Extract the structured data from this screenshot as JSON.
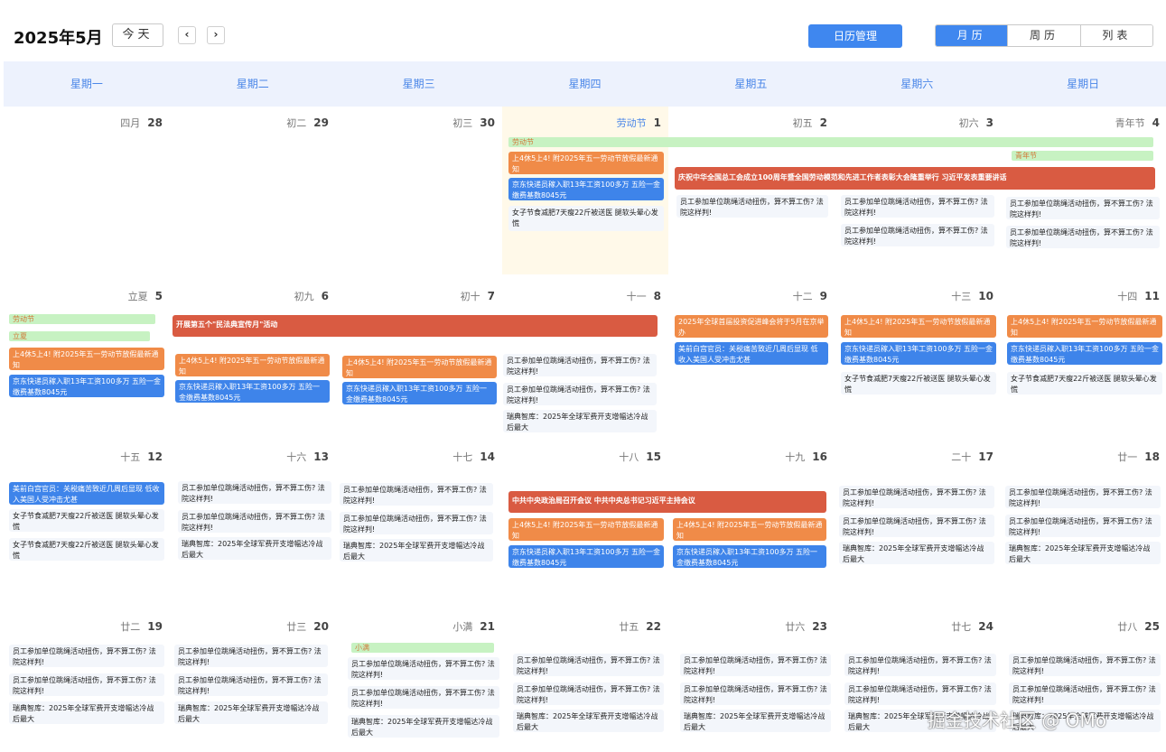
{
  "toolbar": {
    "month_title": "2025年5月",
    "today_label": "今天",
    "prev_icon": "‹",
    "next_icon": "›",
    "manage_label": "日历管理",
    "views": [
      "月历",
      "周历",
      "列表"
    ],
    "active_view": "月历"
  },
  "weekdays": [
    "星期一",
    "星期二",
    "星期三",
    "星期四",
    "星期五",
    "星期六",
    "星期日"
  ],
  "colors": {
    "accent": "#3f87ef",
    "orange": "#f08b48",
    "blue": "#3e84ea",
    "red": "#d95b42",
    "green": "#c7f2c2",
    "today_bg": "#fff9e9"
  },
  "weeks": [
    {
      "days": [
        {
          "lunar": "四月",
          "day": "28"
        },
        {
          "lunar": "初二",
          "day": "29"
        },
        {
          "lunar": "初三",
          "day": "30"
        },
        {
          "lunar": "劳动节",
          "day": "1",
          "festival": true,
          "today": true
        },
        {
          "lunar": "初五",
          "day": "2"
        },
        {
          "lunar": "初六",
          "day": "3"
        },
        {
          "lunar": "青年节",
          "day": "4"
        }
      ],
      "bars": [
        {
          "text": "劳动节",
          "style": "green"
        },
        {
          "text": "青年节",
          "style": "green"
        },
        {
          "text": "庆祝中华全国总工会成立100周年暨全国劳动模范和先进工作者表彰大会隆重举行 习近平发表重要讲话",
          "style": "red"
        }
      ],
      "events": [
        {
          "text": "上4休5上4! 附2025年五一劳动节放假最新通知",
          "style": "orange"
        },
        {
          "text": "京东快递员稼入职13年工资100多万 五险一金缴费基数8045元",
          "style": "blue"
        },
        {
          "text": "女子节食减肥7天瘦22斤被送医 腿软头晕心发慌",
          "style": "plain"
        },
        {
          "text": "员工参加单位跳绳活动扭伤，算不算工伤? 法院这样判!",
          "style": "plain"
        },
        {
          "text": "员工参加单位跳绳活动扭伤，算不算工伤? 法院这样判!",
          "style": "plain"
        },
        {
          "text": "员工参加单位跳绳活动扭伤，算不算工伤? 法院这样判!",
          "style": "plain"
        },
        {
          "text": "员工参加单位跳绳活动扭伤，算不算工伤? 法院这样判!",
          "style": "plain"
        },
        {
          "text": "员工参加单位跳绳活动扭伤，算不算工伤? 法院这样判!",
          "style": "plain"
        }
      ]
    },
    {
      "days": [
        {
          "lunar": "立夏",
          "day": "5"
        },
        {
          "lunar": "初九",
          "day": "6"
        },
        {
          "lunar": "初十",
          "day": "7"
        },
        {
          "lunar": "十一",
          "day": "8"
        },
        {
          "lunar": "十二",
          "day": "9"
        },
        {
          "lunar": "十三",
          "day": "10"
        },
        {
          "lunar": "十四",
          "day": "11"
        }
      ],
      "bars": [
        {
          "text": "劳动节",
          "style": "green"
        },
        {
          "text": "立夏",
          "style": "green"
        },
        {
          "text": "开展第五个\"民法典宣传月\"活动",
          "style": "red"
        }
      ],
      "events": [
        {
          "text": "上4休5上4! 附2025年五一劳动节放假最新通知",
          "style": "orange"
        },
        {
          "text": "京东快递员稼入职13年工资100多万 五险一金缴费基数8045元",
          "style": "blue"
        },
        {
          "text": "上4休5上4! 附2025年五一劳动节放假最新通知",
          "style": "orange"
        },
        {
          "text": "京东快递员稼入职13年工资100多万 五险一金缴费基数8045元",
          "style": "blue"
        },
        {
          "text": "上4休5上4! 附2025年五一劳动节放假最新通知",
          "style": "orange"
        },
        {
          "text": "京东快递员稼入职13年工资100多万 五险一金缴费基数8045元",
          "style": "blue"
        },
        {
          "text": "员工参加单位跳绳活动扭伤，算不算工伤? 法院这样判!",
          "style": "plain"
        },
        {
          "text": "员工参加单位跳绳活动扭伤，算不算工伤? 法院这样判!",
          "style": "plain"
        },
        {
          "text": "瑞典智库：2025年全球军费开支增幅达冷战后最大",
          "style": "plain"
        },
        {
          "text": "2025年全球首届投资促进峰会将于5月在京举办",
          "style": "orange"
        },
        {
          "text": "美前白宫官员：关税痛苦致近几周后显现 低收入美国人受冲击尤甚",
          "style": "blue"
        },
        {
          "text": "上4休5上4! 附2025年五一劳动节放假最新通知",
          "style": "orange"
        },
        {
          "text": "京东快递员稼入职13年工资100多万 五险一金缴费基数8045元",
          "style": "blue"
        },
        {
          "text": "女子节食减肥7天瘦22斤被送医 腿软头晕心发慌",
          "style": "plain"
        },
        {
          "text": "上4休5上4! 附2025年五一劳动节放假最新通知",
          "style": "orange"
        },
        {
          "text": "京东快递员稼入职13年工资100多万 五险一金缴费基数8045元",
          "style": "blue"
        },
        {
          "text": "女子节食减肥7天瘦22斤被送医 腿软头晕心发慌",
          "style": "plain"
        }
      ]
    },
    {
      "days": [
        {
          "lunar": "十五",
          "day": "12"
        },
        {
          "lunar": "十六",
          "day": "13"
        },
        {
          "lunar": "十七",
          "day": "14"
        },
        {
          "lunar": "十八",
          "day": "15"
        },
        {
          "lunar": "十九",
          "day": "16"
        },
        {
          "lunar": "二十",
          "day": "17"
        },
        {
          "lunar": "廿一",
          "day": "18"
        }
      ],
      "bars": [
        {
          "text": "中共中央政治局召开会议 中共中央总书记习近平主持会议",
          "style": "red"
        }
      ],
      "events": [
        {
          "text": "美前白宫官员：关税痛苦致近几周后显现 低收入美国人受冲击尤甚",
          "style": "blue"
        },
        {
          "text": "女子节食减肥7天瘦22斤被送医 腿软头晕心发慌",
          "style": "plain"
        },
        {
          "text": "女子节食减肥7天瘦22斤被送医 腿软头晕心发慌",
          "style": "plain"
        },
        {
          "text": "员工参加单位跳绳活动扭伤，算不算工伤? 法院这样判!",
          "style": "plain"
        },
        {
          "text": "员工参加单位跳绳活动扭伤，算不算工伤? 法院这样判!",
          "style": "plain"
        },
        {
          "text": "瑞典智库：2025年全球军费开支增幅达冷战后最大",
          "style": "plain"
        },
        {
          "text": "员工参加单位跳绳活动扭伤，算不算工伤? 法院这样判!",
          "style": "plain"
        },
        {
          "text": "员工参加单位跳绳活动扭伤，算不算工伤? 法院这样判!",
          "style": "plain"
        },
        {
          "text": "瑞典智库：2025年全球军费开支增幅达冷战后最大",
          "style": "plain"
        },
        {
          "text": "上4休5上4! 附2025年五一劳动节放假最新通知",
          "style": "orange"
        },
        {
          "text": "京东快递员稼入职13年工资100多万 五险一金缴费基数8045元",
          "style": "blue"
        },
        {
          "text": "上4休5上4! 附2025年五一劳动节放假最新通知",
          "style": "orange"
        },
        {
          "text": "京东快递员稼入职13年工资100多万 五险一金缴费基数8045元",
          "style": "blue"
        },
        {
          "text": "员工参加单位跳绳活动扭伤，算不算工伤? 法院这样判!",
          "style": "plain"
        },
        {
          "text": "员工参加单位跳绳活动扭伤，算不算工伤? 法院这样判!",
          "style": "plain"
        },
        {
          "text": "瑞典智库：2025年全球军费开支增幅达冷战后最大",
          "style": "plain"
        },
        {
          "text": "员工参加单位跳绳活动扭伤，算不算工伤? 法院这样判!",
          "style": "plain"
        },
        {
          "text": "员工参加单位跳绳活动扭伤，算不算工伤? 法院这样判!",
          "style": "plain"
        },
        {
          "text": "瑞典智库：2025年全球军费开支增幅达冷战后最大",
          "style": "plain"
        }
      ]
    },
    {
      "days": [
        {
          "lunar": "廿二",
          "day": "19"
        },
        {
          "lunar": "廿三",
          "day": "20"
        },
        {
          "lunar": "小满",
          "day": "21"
        },
        {
          "lunar": "廿五",
          "day": "22"
        },
        {
          "lunar": "廿六",
          "day": "23"
        },
        {
          "lunar": "廿七",
          "day": "24"
        },
        {
          "lunar": "廿八",
          "day": "25"
        }
      ],
      "bars": [
        {
          "text": "小满",
          "style": "green"
        }
      ],
      "events": [
        {
          "text": "员工参加单位跳绳活动扭伤，算不算工伤? 法院这样判!",
          "style": "plain"
        },
        {
          "text": "员工参加单位跳绳活动扭伤，算不算工伤? 法院这样判!",
          "style": "plain"
        },
        {
          "text": "瑞典智库：2025年全球军费开支增幅达冷战后最大",
          "style": "plain"
        },
        {
          "text": "员工参加单位跳绳活动扭伤，算不算工伤? 法院这样判!",
          "style": "plain"
        },
        {
          "text": "员工参加单位跳绳活动扭伤，算不算工伤? 法院这样判!",
          "style": "plain"
        },
        {
          "text": "瑞典智库：2025年全球军费开支增幅达冷战后最大",
          "style": "plain"
        },
        {
          "text": "员工参加单位跳绳活动扭伤，算不算工伤? 法院这样判!",
          "style": "plain"
        },
        {
          "text": "员工参加单位跳绳活动扭伤，算不算工伤? 法院这样判!",
          "style": "plain"
        },
        {
          "text": "瑞典智库：2025年全球军费开支增幅达冷战后最大",
          "style": "plain"
        },
        {
          "text": "员工参加单位跳绳活动扭伤，算不算工伤? 法院这样判!",
          "style": "plain"
        },
        {
          "text": "员工参加单位跳绳活动扭伤，算不算工伤? 法院这样判!",
          "style": "plain"
        },
        {
          "text": "瑞典智库：2025年全球军费开支增幅达冷战后最大",
          "style": "plain"
        },
        {
          "text": "员工参加单位跳绳活动扭伤，算不算工伤? 法院这样判!",
          "style": "plain"
        },
        {
          "text": "员工参加单位跳绳活动扭伤，算不算工伤? 法院这样判!",
          "style": "plain"
        },
        {
          "text": "瑞典智库：2025年全球军费开支增幅达冷战后最大",
          "style": "plain"
        },
        {
          "text": "员工参加单位跳绳活动扭伤，算不算工伤? 法院这样判!",
          "style": "plain"
        },
        {
          "text": "员工参加单位跳绳活动扭伤，算不算工伤? 法院这样判!",
          "style": "plain"
        },
        {
          "text": "瑞典智库：2025年全球军费开支增幅达冷战后最大",
          "style": "plain"
        },
        {
          "text": "员工参加单位跳绳活动扭伤，算不算工伤? 法院这样判!",
          "style": "plain"
        },
        {
          "text": "员工参加单位跳绳活动扭伤，算不算工伤? 法院这样判!",
          "style": "plain"
        },
        {
          "text": "瑞典智库：2025年全球军费开支增幅达冷战后最大",
          "style": "plain"
        }
      ]
    }
  ],
  "watermark": "掘金技术社区 @ OMo"
}
